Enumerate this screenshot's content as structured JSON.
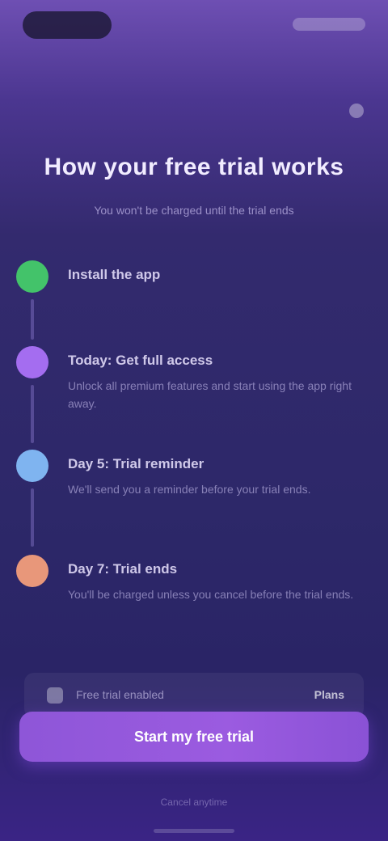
{
  "header": {
    "title": "How your free trial works",
    "subtitle": "You won't be charged until the trial ends"
  },
  "timeline": [
    {
      "title": "Install the app",
      "desc": "",
      "color": "#43c36a",
      "icon": "check-icon"
    },
    {
      "title": "Today: Get full access",
      "desc": "Unlock all premium features and start using the app right away.",
      "color": "#a46df0",
      "icon": "lock-icon"
    },
    {
      "title": "Day 5: Trial reminder",
      "desc": "We'll send you a reminder before your trial ends.",
      "color": "#7fb4f0",
      "icon": "bell-icon"
    },
    {
      "title": "Day 7: Trial ends",
      "desc": "You'll be charged unless you cancel before the trial ends.",
      "color": "#e8977a",
      "icon": "star-icon"
    }
  ],
  "notice": {
    "text": "Free trial enabled",
    "link": "Plans"
  },
  "cta": {
    "label": "Start my free trial"
  },
  "footnote": "Cancel anytime"
}
